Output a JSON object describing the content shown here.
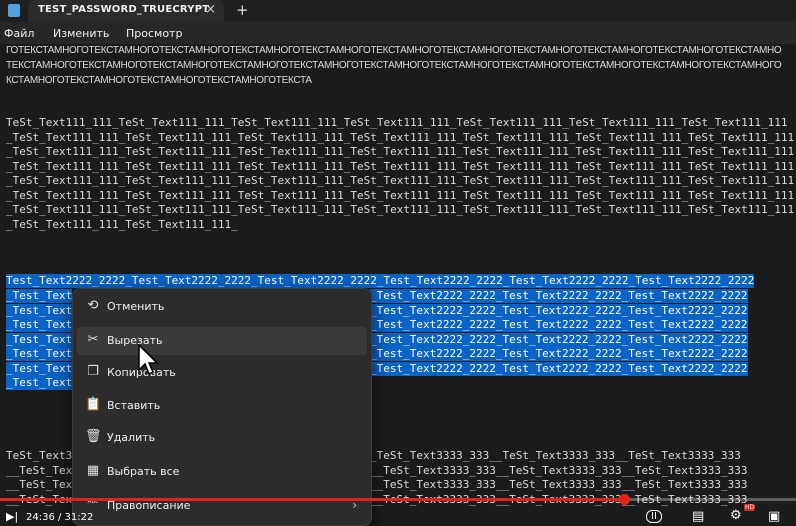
{
  "window": {
    "tab_title": "TEST_PASSWORD_TRUECRYPT",
    "close_glyph": "×",
    "new_tab_glyph": "+"
  },
  "menu": {
    "file": "Файл",
    "edit": "Изменить",
    "view": "Просмотр"
  },
  "editor": {
    "cyr_lines": [
      "ГОТЕКСТАМНОГОТЕКСТАМНОГОТЕКСТАМНОГОТЕКСТАМНОГОТЕКСТАМНОГОТЕКСТАМНОГОТЕКСТАМНОГОТЕКСТАМНОГОТЕКСТАМНОГОТЕКСТАМНОГОТЕКСТАМНО",
      "ТЕКСТАМНОГОТЕКСТАМНОГОТЕКСТАМНОГОТЕКСТАМНОГОТЕКСТАМНОГОТЕКСТАМНОГОТЕКСТАМНОГОТЕКСТАМНОГОТЕКСТАМНОГОТЕКСТАМНОГОТЕКСТАМНОГО",
      "КСТАМНОГОТЕКСТАМНОГОТЕКСТАМНОГОТЕКСТАМНОГОТЕКСТА"
    ],
    "text1_lines": [
      "TeSt_Text111_111_TeSt_Text111_111_TeSt_Text111_111_TeSt_Text111_111_TeSt_Text111_111_TeSt_Text111_111_TeSt_Text111_111",
      "_TeSt_Text111_111_TeSt_Text111_111_TeSt_Text111_111_TeSt_Text111_111_TeSt_Text111_111_TeSt_Text111_111_TeSt_Text111_111",
      "_TeSt_Text111_111_TeSt_Text111_111_TeSt_Text111_111_TeSt_Text111_111_TeSt_Text111_111_TeSt_Text111_111_TeSt_Text111_111",
      "_TeSt_Text111_111_TeSt_Text111_111_TeSt_Text111_111_TeSt_Text111_111_TeSt_Text111_111_TeSt_Text111_111_TeSt_Text111_111",
      "_TeSt_Text111_111_TeSt_Text111_111_TeSt_Text111_111_TeSt_Text111_111_TeSt_Text111_111_TeSt_Text111_111_TeSt_Text111_111",
      "_TeSt_Text111_111_TeSt_Text111_111_TeSt_Text111_111_TeSt_Text111_111_TeSt_Text111_111_TeSt_Text111_111_TeSt_Text111_111",
      "_TeSt_Text111_111_TeSt_Text111_111_TeSt_Text111_111_TeSt_Text111_111_TeSt_Text111_111_TeSt_Text111_111_TeSt_Text111_111",
      "_TeSt_Text111_111_TeSt_Text111_111_"
    ],
    "text2_first": "Test_Text2222_2222_Test_Text2222_2222_Test_Text2222_2222_Test_Text2222_2222_Test_Text2222_2222_Test_Text2222_2222",
    "text2_head": "_Test_Text",
    "text2_tail": "_Test_Text2222_2222_Test_Text2222_2222_Test_Text2222_2222",
    "text2_row_count": 7,
    "text3_first_head": "TeSt_Text3",
    "text3_first_tail": "_TeSt_Text3333_333__TeSt_Text3333_333__TeSt_Text3333_333",
    "text3_head": "__TeSt_Tex",
    "text3_tail": "__TeSt_Text3333_333__TeSt_Text3333_333__TeSt_Text3333_333"
  },
  "context_menu": {
    "items": [
      {
        "icon": "undo-icon",
        "glyph": "⟲",
        "label": "Отменить"
      },
      {
        "icon": "scissors-icon",
        "glyph": "✂",
        "label": "Вырезать"
      },
      {
        "icon": "copy-icon",
        "glyph": "❐",
        "label": "Копировать"
      },
      {
        "icon": "paste-icon",
        "glyph": "📋",
        "label": "Вставить"
      },
      {
        "icon": "trash-icon",
        "glyph": "🗑",
        "label": "Удалить"
      },
      {
        "icon": "select-all-icon",
        "glyph": "▦",
        "label": "Выбрать все"
      },
      {
        "icon": "spellcheck-icon",
        "glyph": "ᴬᴮᶜ",
        "label": "Правописание"
      }
    ],
    "hovered": "Вырезать"
  },
  "video": {
    "time": "24:36 / 31:22",
    "progress": 0.784,
    "accent": "#e62117",
    "badge": "HD"
  },
  "colors": {
    "selection": "#0b63c6",
    "background": "#1b1b1b"
  }
}
